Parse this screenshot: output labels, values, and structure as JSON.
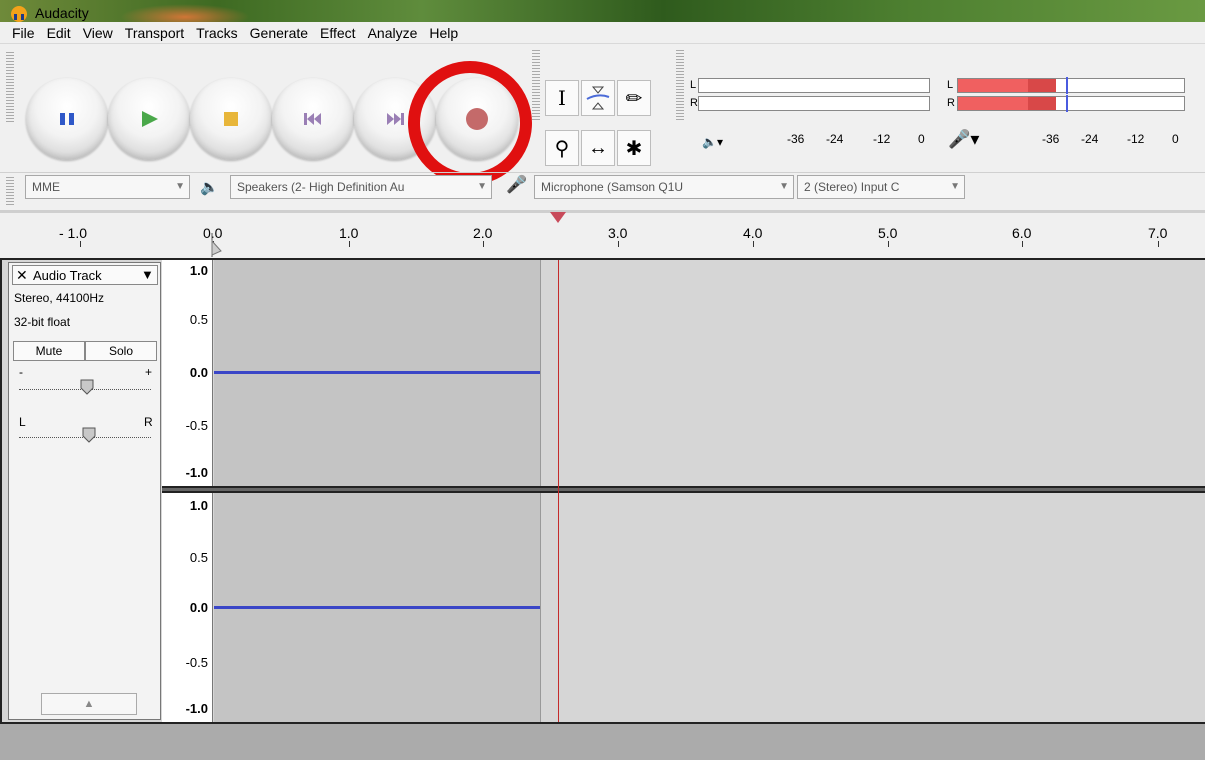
{
  "window": {
    "title": "Audacity"
  },
  "menu": [
    "File",
    "Edit",
    "View",
    "Transport",
    "Tracks",
    "Generate",
    "Effect",
    "Analyze",
    "Help"
  ],
  "transport": {
    "pause": "pause-icon",
    "play": "play-icon",
    "stop": "stop-icon",
    "skip_start": "skip-to-start-icon",
    "skip_end": "skip-to-end-icon",
    "record": "record-icon",
    "highlight_color": "#e01010"
  },
  "tools": {
    "selection": "I",
    "envelope": "envelope-icon",
    "draw": "✏",
    "zoom": "⚲",
    "timeshift": "↔",
    "multi": "✱"
  },
  "meters": {
    "play_channels": [
      "L",
      "R"
    ],
    "record_channels": [
      "L",
      "R"
    ],
    "play_scale": [
      "-36",
      "-24",
      "-12",
      "0"
    ],
    "record_scale": [
      "-36",
      "-24",
      "-12",
      "0"
    ],
    "record_level_color": "#f06060"
  },
  "devices": {
    "host": "MME",
    "output": "Speakers (2- High Definition Au",
    "input": "Microphone (Samson Q1U",
    "channels": "2 (Stereo) Input C"
  },
  "timeline": {
    "labels": [
      "- 1.0",
      "0.0",
      "1.0",
      "2.0",
      "3.0",
      "4.0",
      "5.0",
      "6.0",
      "7.0"
    ]
  },
  "track": {
    "name": "Audio Track",
    "close": "✕",
    "menu_arrow": "▼",
    "info1": "Stereo, 44100Hz",
    "info2": "32-bit float",
    "mute": "Mute",
    "solo": "Solo",
    "gain_minus": "-",
    "gain_plus": "+",
    "pan_left": "L",
    "pan_right": "R",
    "collapse": "▲",
    "ruler": [
      "1.0",
      "0.5",
      "0.0",
      "-0.5",
      "-1.0"
    ],
    "wave_color": "#3a46c7",
    "cursor_color": "#c42a2a"
  }
}
